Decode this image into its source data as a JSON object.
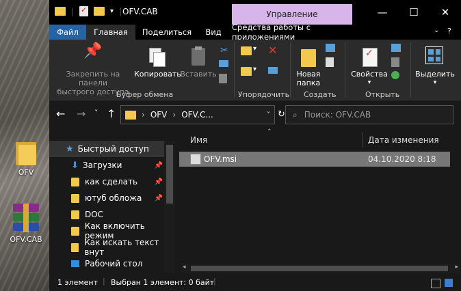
{
  "desktop": {
    "icons": [
      {
        "label": "OFV",
        "icon": "folder-icon"
      },
      {
        "label": "OFV.CAB",
        "icon": "winrar-archive-icon"
      }
    ]
  },
  "window": {
    "title": "OFV.CAB",
    "contextual_tab_header": "Управление",
    "controls": {
      "minimize": "—",
      "maximize": "☐",
      "close": "✕"
    }
  },
  "ribbon_tabs": [
    {
      "label": "Файл"
    },
    {
      "label": "Главная"
    },
    {
      "label": "Поделиться"
    },
    {
      "label": "Вид"
    },
    {
      "label": "Средства работы с приложениями"
    }
  ],
  "ribbon": {
    "pin_label_1": "Закрепить на панели",
    "pin_label_2": "быстрого доступа",
    "copy_label": "Копировать",
    "paste_label": "Вставить",
    "new_folder_label_1": "Новая",
    "new_folder_label_2": "папка",
    "properties_label": "Свойства",
    "select_label": "Выделить",
    "groups": {
      "clipboard": "Буфер обмена",
      "organize": "Упорядочить",
      "create": "Создать",
      "open": "Открыть"
    }
  },
  "address": {
    "crumbs": [
      "OFV",
      "OFV.C..."
    ],
    "search_placeholder": "Поиск: OFV.CAB"
  },
  "nav_pane": {
    "items": [
      {
        "label": "Быстрый доступ",
        "icon": "star-icon",
        "pinned": false
      },
      {
        "label": "Загрузки",
        "icon": "download-icon",
        "pinned": true
      },
      {
        "label": "как сделать",
        "icon": "folder-icon",
        "pinned": true
      },
      {
        "label": "ютуб обложа",
        "icon": "folder-icon",
        "pinned": true
      },
      {
        "label": "DOC",
        "icon": "folder-icon",
        "pinned": false
      },
      {
        "label": "Как включить режим",
        "icon": "folder-icon",
        "pinned": false
      },
      {
        "label": "Как искать текст внут",
        "icon": "folder-icon",
        "pinned": false
      },
      {
        "label": "Рабочий стол",
        "icon": "desktop-icon",
        "pinned": false
      }
    ]
  },
  "file_list": {
    "columns": [
      "Имя",
      "Дата изменения"
    ],
    "rows": [
      {
        "name": "OFV.msi",
        "date": "04.10.2020 8:18",
        "selected": true
      }
    ]
  },
  "status": {
    "count": "1 элемент",
    "selection": "Выбран 1 элемент: 0 байт"
  },
  "colors": {
    "file_tab": "#2463a5",
    "manage_tab": "#d7b4ea",
    "folder": "#f2c94c",
    "selection": "#777777"
  }
}
